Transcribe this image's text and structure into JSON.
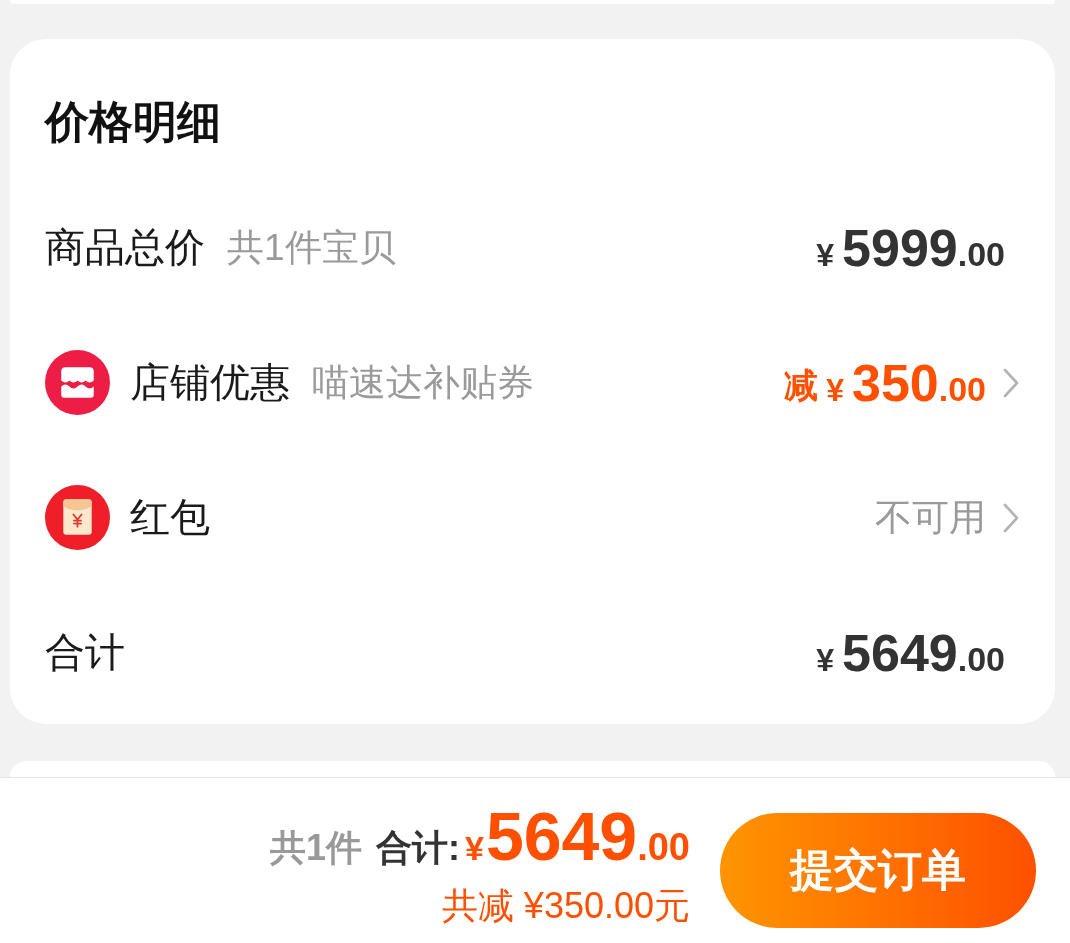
{
  "price_detail": {
    "title": "价格明细",
    "rows": [
      {
        "kind": "subtotal",
        "label": "商品总价",
        "note": "共1件宝贝",
        "amount": {
          "currency": "¥",
          "integer": "5999",
          "decimal": ".00"
        }
      },
      {
        "kind": "shop_discount",
        "label": "店铺优惠",
        "note": "喵速达补贴券",
        "prefix": "减",
        "amount": {
          "currency": "¥",
          "integer": "350",
          "decimal": ".00"
        }
      },
      {
        "kind": "red_packet",
        "label": "红包",
        "status": "不可用"
      },
      {
        "kind": "total",
        "label": "合计",
        "amount": {
          "currency": "¥",
          "integer": "5649",
          "decimal": ".00"
        }
      }
    ]
  },
  "checkout_bar": {
    "item_count": "共1件",
    "total_label": "合计:",
    "total": {
      "currency": "¥",
      "integer": "5649",
      "decimal": ".00"
    },
    "savings": "共减 ¥350.00元",
    "submit_button": "提交订单"
  }
}
